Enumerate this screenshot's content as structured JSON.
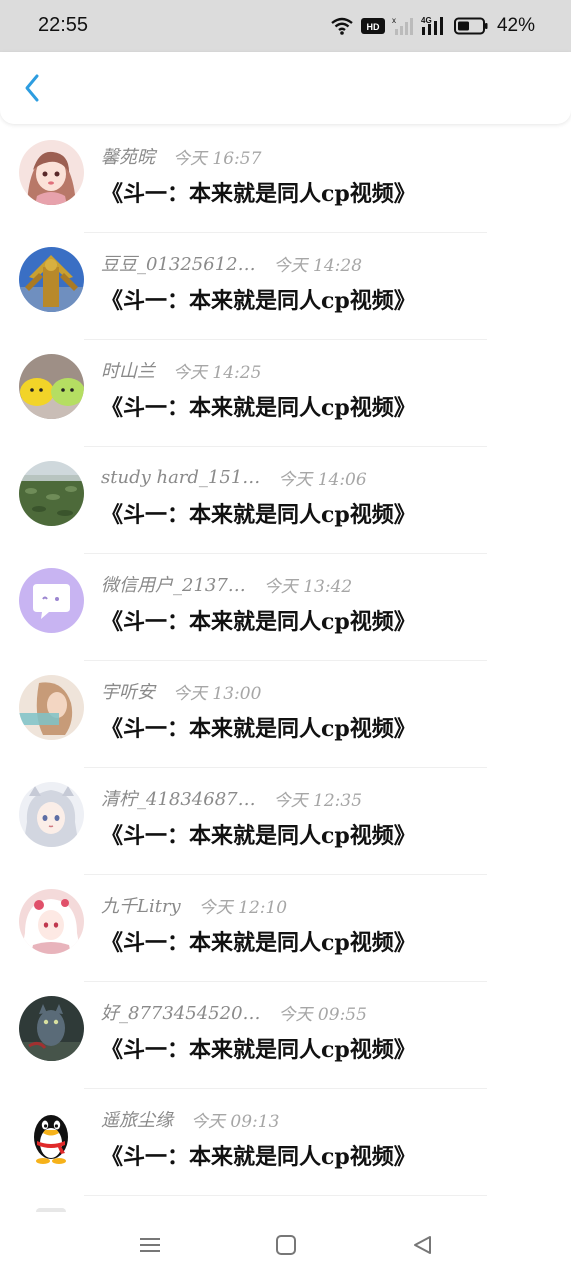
{
  "status_bar": {
    "time": "22:55",
    "battery": "42%",
    "icons": [
      "wifi-icon",
      "hd-icon",
      "signal-weak-icon",
      "4g-signal-icon",
      "battery-icon"
    ]
  },
  "header": {
    "back_icon": "chevron-left-icon",
    "accent_color": "#2d9de0"
  },
  "messages": [
    {
      "name": "馨苑晥",
      "time": "今天 16:57",
      "text": "《斗一：本来就是同人cp视频》",
      "avatar": "anime-girl-pink"
    },
    {
      "name": "豆豆_01325612…",
      "time": "今天 14:28",
      "text": "《斗一：本来就是同人cp视频》",
      "avatar": "golden-statue"
    },
    {
      "name": "时山兰",
      "time": "今天 14:25",
      "text": "《斗一：本来就是同人cp视频》",
      "avatar": "cute-blobs"
    },
    {
      "name": "study hard_151…",
      "time": "今天 14:06",
      "text": "《斗一：本来就是同人cp视频》",
      "avatar": "lotus-field"
    },
    {
      "name": "微信用户_2137…",
      "time": "今天 13:42",
      "text": "《斗一：本来就是同人cp视频》",
      "avatar": "purple-chat-bubble"
    },
    {
      "name": "宇听安",
      "time": "今天 13:00",
      "text": "《斗一：本来就是同人cp视频》",
      "avatar": "girl-photo"
    },
    {
      "name": "清柠_41834687…",
      "time": "今天 12:35",
      "text": "《斗一：本来就是同人cp视频》",
      "avatar": "anime-silver-hair"
    },
    {
      "name": "九千Litry",
      "time": "今天 12:10",
      "text": "《斗一：本来就是同人cp视频》",
      "avatar": "anime-white-hair"
    },
    {
      "name": "好_8773454520…",
      "time": "今天 09:55",
      "text": "《斗一：本来就是同人cp视频》",
      "avatar": "dark-cat"
    },
    {
      "name": "遥旅尘缘",
      "time": "今天 09:13",
      "text": "《斗一：本来就是同人cp视频》",
      "avatar": "qq-penguin"
    }
  ],
  "nav_bar": {
    "icons": [
      "menu-icon",
      "home-square-icon",
      "back-triangle-icon"
    ]
  }
}
